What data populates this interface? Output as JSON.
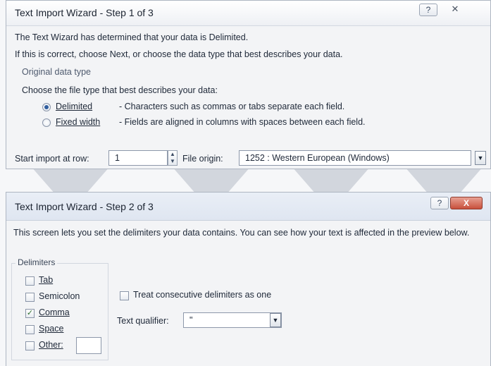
{
  "window1": {
    "title": "Text Import Wizard - Step 1 of 3",
    "help_button": "?",
    "close_button": "✕",
    "heading": "The Text Wizard has determined that your data is Delimited.",
    "instruction": "If this is correct, choose Next, or choose the data type that best describes your data.",
    "section_title": "Original data type",
    "file_type_prompt": "Choose the file type that best describes your data:",
    "options": [
      {
        "label": "Delimited",
        "description": "- Characters such as commas or tabs separate each field.",
        "selected": true
      },
      {
        "label": "Fixed width",
        "description": "- Fields are aligned in columns with spaces between each field.",
        "selected": false
      }
    ],
    "start_import_label": "Start import at row:",
    "start_import_value": "1",
    "file_origin_label": "File origin:",
    "file_origin_value": "1252 : Western European (Windows)"
  },
  "window2": {
    "title": "Text Import Wizard - Step 2 of 3",
    "help_button": "?",
    "close_button": "X",
    "description": "This screen lets you set the delimiters your data contains.  You can see how your text is affected in the preview below.",
    "delimiters_label": "Delimiters",
    "delimiters": [
      {
        "label": "Tab",
        "checked": false
      },
      {
        "label": "Semicolon",
        "checked": false
      },
      {
        "label": "Comma",
        "checked": true
      },
      {
        "label": "Space",
        "checked": false
      },
      {
        "label": "Other:",
        "checked": false
      }
    ],
    "other_value": "",
    "treat_consecutive_label": "Treat consecutive delimiters as one",
    "treat_consecutive_checked": false,
    "text_qualifier_label": "Text qualifier:",
    "text_qualifier_value": "\""
  },
  "colors": {
    "accent": "#2f5d9e",
    "close_red": "#c8503c"
  }
}
